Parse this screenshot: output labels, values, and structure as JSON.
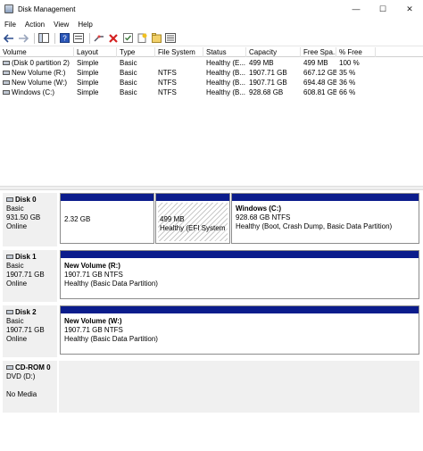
{
  "window": {
    "title": "Disk Management",
    "minimize": "—",
    "maximize": "☐",
    "close": "✕"
  },
  "menu": {
    "items": [
      "File",
      "Action",
      "View",
      "Help"
    ]
  },
  "toolbar": {
    "buttons": [
      "back-arrow-icon",
      "forward-arrow-icon",
      "console-tree-icon",
      "help-icon",
      "properties-icon",
      "connect-icon",
      "delete-icon",
      "check-icon",
      "new-icon",
      "open-icon",
      "list-view-icon"
    ]
  },
  "volume_table": {
    "columns": [
      "Volume",
      "Layout",
      "Type",
      "File System",
      "Status",
      "Capacity",
      "Free Spa...",
      "% Free"
    ],
    "rows": [
      [
        "(Disk 0 partition 2)",
        "Simple",
        "Basic",
        "",
        "Healthy (E...",
        "499 MB",
        "499 MB",
        "100 %"
      ],
      [
        "New Volume (R:)",
        "Simple",
        "Basic",
        "NTFS",
        "Healthy (B...",
        "1907.71 GB",
        "667.12 GB",
        "35 %"
      ],
      [
        "New Volume (W:)",
        "Simple",
        "Basic",
        "NTFS",
        "Healthy (B...",
        "1907.71 GB",
        "694.48 GB",
        "36 %"
      ],
      [
        "Windows (C:)",
        "Simple",
        "Basic",
        "NTFS",
        "Healthy (B...",
        "928.68 GB",
        "608.81 GB",
        "66 %"
      ]
    ]
  },
  "disks": [
    {
      "name": "Disk 0",
      "type": "Basic",
      "size": "931.50 GB",
      "state": "Online",
      "partitions": [
        {
          "title": "",
          "line1": "2.32 GB",
          "line2": ""
        },
        {
          "title": "",
          "line1": "499 MB",
          "line2": "Healthy (EFI System Pa"
        },
        {
          "title": "Windows  (C:)",
          "line1": "928.68 GB NTFS",
          "line2": "Healthy (Boot, Crash Dump, Basic Data Partition)"
        }
      ]
    },
    {
      "name": "Disk 1",
      "type": "Basic",
      "size": "1907.71 GB",
      "state": "Online",
      "partitions": [
        {
          "title": "New Volume  (R:)",
          "line1": "1907.71 GB NTFS",
          "line2": "Healthy (Basic Data Partition)"
        }
      ]
    },
    {
      "name": "Disk 2",
      "type": "Basic",
      "size": "1907.71 GB",
      "state": "Online",
      "partitions": [
        {
          "title": "New Volume  (W:)",
          "line1": "1907.71 GB NTFS",
          "line2": "Healthy (Basic Data Partition)"
        }
      ]
    },
    {
      "name": "CD-ROM 0",
      "type": "DVD (D:)",
      "size": "",
      "state": "No Media",
      "partitions": []
    }
  ],
  "colors": {
    "partition_bar": "#0b1c8c",
    "label_bg": "#f0f0f0"
  }
}
